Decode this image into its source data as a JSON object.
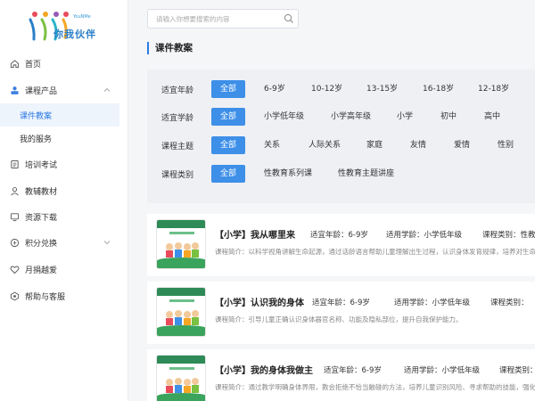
{
  "brand": {
    "name_cn": "你我伙伴",
    "name_en": "YouNMe"
  },
  "sidebar": {
    "items": [
      {
        "label": "首页",
        "icon": "home-icon"
      },
      {
        "label": "课程产品",
        "icon": "course-icon"
      },
      {
        "label": "培训考试",
        "icon": "exam-icon"
      },
      {
        "label": "教辅教材",
        "icon": "user-icon"
      },
      {
        "label": "资源下载",
        "icon": "monitor-icon"
      },
      {
        "label": "积分兑换",
        "icon": "points-icon"
      },
      {
        "label": "月捐越爱",
        "icon": "heart-icon"
      },
      {
        "label": "帮助与客服",
        "icon": "help-icon"
      }
    ],
    "sub_items": [
      {
        "label": "课件教案",
        "active": true
      },
      {
        "label": "我的服务",
        "active": false
      }
    ]
  },
  "search": {
    "placeholder": "请输入你想要搜索的内容"
  },
  "page": {
    "title": "课件教案"
  },
  "filters": [
    {
      "label": "适宜年龄",
      "options": [
        "全部",
        "6-9岁",
        "10-12岁",
        "13-15岁",
        "16-18岁",
        "12-18岁"
      ]
    },
    {
      "label": "适宜学龄",
      "options": [
        "全部",
        "小学低年级",
        "小学高年级",
        "小学",
        "初中",
        "高中"
      ]
    },
    {
      "label": "课程主题",
      "options": [
        "全部",
        "关系",
        "人际关系",
        "家庭",
        "友情",
        "爱情",
        "性别"
      ]
    },
    {
      "label": "课程类别",
      "options": [
        "全部",
        "性教育系列课",
        "性教育主题讲座"
      ]
    }
  ],
  "courses": [
    {
      "title": "【小学】我从哪里来",
      "age": "适宜年龄：6-9岁",
      "grade": "适用学龄：小学低年级",
      "category": "课程类别：性教",
      "desc": "课程简介：以科学视角讲解生命起源，通过话龄语言帮助儿童理解出生过程，认识身体发育规律，培养对生命"
    },
    {
      "title": "【小学】认识我的身体",
      "age": "适宜年龄：6-9岁",
      "grade": "适用学龄：小学低年级",
      "category": "课程类别：",
      "desc": "课程简介：引导儿童正确认识身体器官名称、功能及隐私部位，提升自我保护能力。"
    },
    {
      "title": "【小学】我的身体我做主",
      "age": "适宜年龄：6-9岁",
      "grade": "适用学龄：小学低年级",
      "category": "课程类别：",
      "desc": "课程简介：通过教学明确身体界限，教会拒绝不恰当触碰的方法，培养儿童识别风险、寻求帮助的技能，强化"
    }
  ],
  "colors": {
    "accent": "#3d8fe8",
    "active_bg": "#eef4fc",
    "filter_bg": "#eef0f4"
  }
}
